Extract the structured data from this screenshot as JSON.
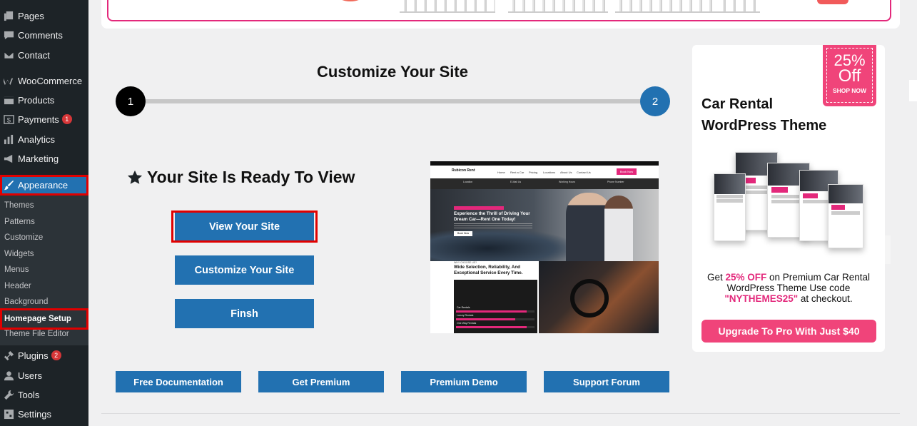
{
  "sidebar": {
    "items": [
      {
        "label": "Pages",
        "icon": "pages-icon"
      },
      {
        "label": "Comments",
        "icon": "comments-icon"
      },
      {
        "label": "Contact",
        "icon": "mail-icon"
      },
      {
        "label": "WooCommerce",
        "icon": "woocommerce-icon"
      },
      {
        "label": "Products",
        "icon": "products-icon"
      },
      {
        "label": "Payments",
        "icon": "payments-icon",
        "badge": "1"
      },
      {
        "label": "Analytics",
        "icon": "analytics-icon"
      },
      {
        "label": "Marketing",
        "icon": "marketing-icon"
      },
      {
        "label": "Appearance",
        "icon": "brush-icon"
      }
    ],
    "appearance_submenu": [
      "Themes",
      "Patterns",
      "Customize",
      "Widgets",
      "Menus",
      "Header",
      "Background",
      "Homepage Setup",
      "Theme File Editor"
    ],
    "bottom_items": [
      {
        "label": "Plugins",
        "icon": "plugins-icon",
        "badge": "2"
      },
      {
        "label": "Users",
        "icon": "users-icon"
      },
      {
        "label": "Tools",
        "icon": "tools-icon"
      },
      {
        "label": "Settings",
        "icon": "settings-icon"
      }
    ]
  },
  "main": {
    "title": "Customize Your Site",
    "steps": [
      "1",
      "2"
    ],
    "ready_heading": "Your Site Is Ready To View",
    "buttons": {
      "view": "View Your Site",
      "customize": "Customize Your Site",
      "finish": "Finsh"
    },
    "bottom_buttons": [
      "Free Documentation",
      "Get Premium",
      "Premium Demo",
      "Support Forum"
    ]
  },
  "preview": {
    "logo": "Rubicon Rent",
    "nav": [
      "Home",
      "Rent a Car",
      "Pricing",
      "Locations",
      "About Us",
      "Contact Us"
    ],
    "get_button": "Book Now",
    "info": [
      "Location",
      "E-Mail Us",
      "Working Hours",
      "Phone Number"
    ],
    "hero_title": "Experience the Thrill of Driving Your Dream Car—Rent One Today!",
    "hero_button": "Book Now",
    "section_label": "WHY CHOOSE US?",
    "section_title": "Wide Selection, Reliability, And Exceptional Service Every Time.",
    "bars": [
      {
        "label": "Car Rentals",
        "value": 90
      },
      {
        "label": "Luxury Rentals",
        "value": 75
      },
      {
        "label": "One Way Rentals",
        "value": 90
      }
    ]
  },
  "promo": {
    "badge_pct": "25%",
    "badge_off": "Off",
    "badge_shop": "SHOP NOW",
    "title": "Car Rental WordPress Theme",
    "text_pre": "Get ",
    "text_highlight": "25% OFF",
    "text_mid": " on Premium Car Rental WordPress Theme Use code ",
    "code": "\"NYTHEMES25\"",
    "text_post": " at checkout.",
    "button": "Upgrade To Pro With Just $40",
    "accent": "#f0447a"
  },
  "colors": {
    "primary": "#2271b1",
    "sidebar_bg": "#1d2327",
    "highlight_outline": "#e10000"
  }
}
